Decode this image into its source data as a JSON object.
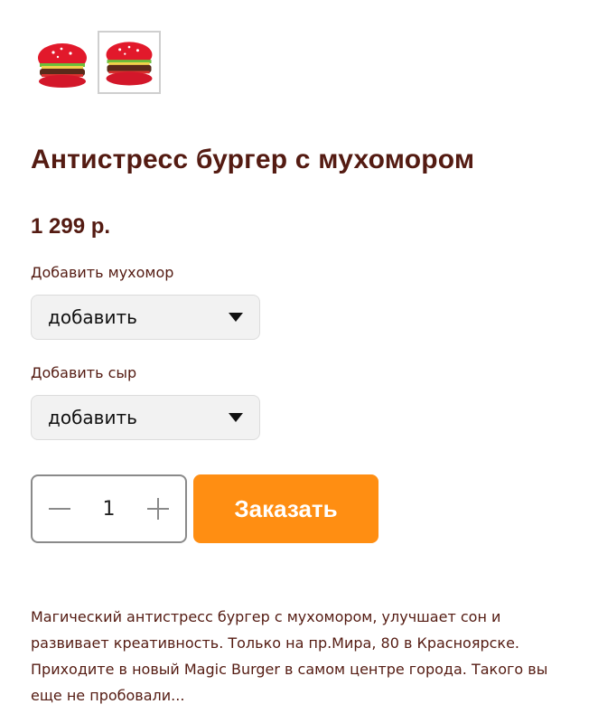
{
  "product": {
    "title": "Антистресс бургер с мухомором",
    "price": "1 299 р.",
    "thumbnails": [
      {
        "icon": "red-burger-image"
      },
      {
        "icon": "red-burger-image",
        "selected": true
      }
    ]
  },
  "options": [
    {
      "label": "Добавить мухомор",
      "value": "добавить"
    },
    {
      "label": "Добавить сыр",
      "value": "добавить"
    }
  ],
  "quantity": {
    "value": "1"
  },
  "order_button": {
    "label": "Заказать"
  },
  "description": {
    "lines": [
      "Магический антистресс бургер с мухомором, улучшает сон и",
      "развивает креативность. Только на пр.Мира, 80 в Красноярске.",
      "Приходите в новый Magic Burger в самом центре города. Такого вы",
      "еще не пробовали..."
    ]
  },
  "colors": {
    "accent": "#ff8e12",
    "text": "#541b12"
  }
}
